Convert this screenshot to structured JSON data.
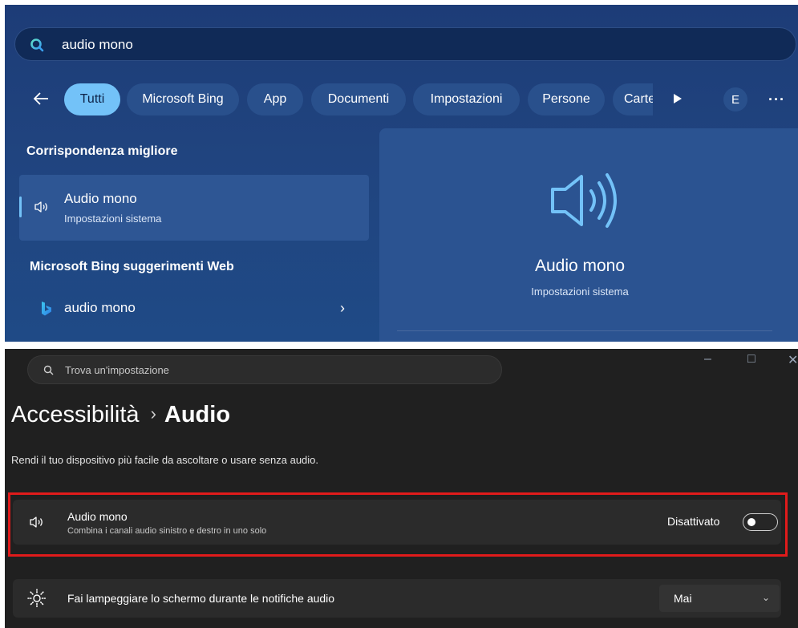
{
  "search_panel": {
    "query": "audio mono",
    "filters": [
      "Tutti",
      "Microsoft Bing",
      "App",
      "Documenti",
      "Impostazioni",
      "Persone",
      "Cartelle"
    ],
    "avatar_initial": "E",
    "more_label": "···",
    "best_match": {
      "heading": "Corrispondenza migliore",
      "title": "Audio mono",
      "subtitle": "Impostazioni sistema"
    },
    "web": {
      "heading": "Microsoft Bing suggerimenti Web",
      "suggestion": "audio mono",
      "chevron": "›"
    },
    "preview": {
      "title": "Audio mono",
      "subtitle": "Impostazioni sistema"
    },
    "colors": {
      "accent": "#73c2f8",
      "background": "#1f4580"
    }
  },
  "settings": {
    "search_placeholder": "Trova un'impostazione",
    "window_controls": [
      "–",
      "□",
      "✕"
    ],
    "breadcrumb": {
      "parent": "Accessibilità",
      "separator": "›",
      "current": "Audio"
    },
    "description": "Rendi il tuo dispositivo più facile da ascoltare o usare senza audio.",
    "mono_audio": {
      "title": "Audio mono",
      "subtitle": "Combina i canali audio sinistro e destro in uno solo",
      "state_label": "Disattivato",
      "enabled": false
    },
    "flash_screen": {
      "title": "Fai lampeggiare lo schermo durante le notifiche audio",
      "selected_option": "Mai",
      "chevron": "⌄"
    },
    "colors": {
      "background": "#202020",
      "highlight": "#e01b1b"
    }
  }
}
